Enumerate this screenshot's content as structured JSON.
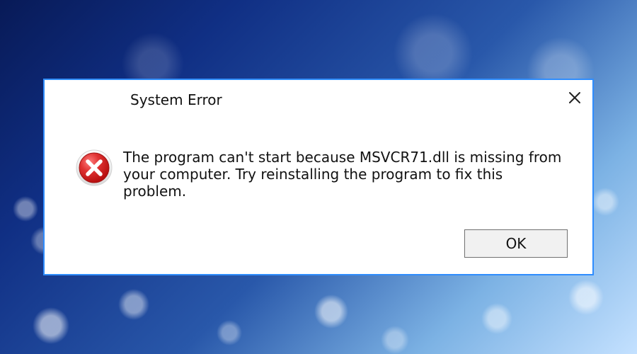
{
  "dialog": {
    "title": "System Error",
    "message": "The program can't start because MSVCR71.dll is missing from your computer. Try reinstalling the program to fix this problem.",
    "ok_label": "OK",
    "icons": {
      "close": "close-icon",
      "error": "error-icon"
    },
    "colors": {
      "accent": "#2f8dff",
      "error_red": "#d62d2d",
      "button_bg": "#f1f1f1"
    }
  }
}
